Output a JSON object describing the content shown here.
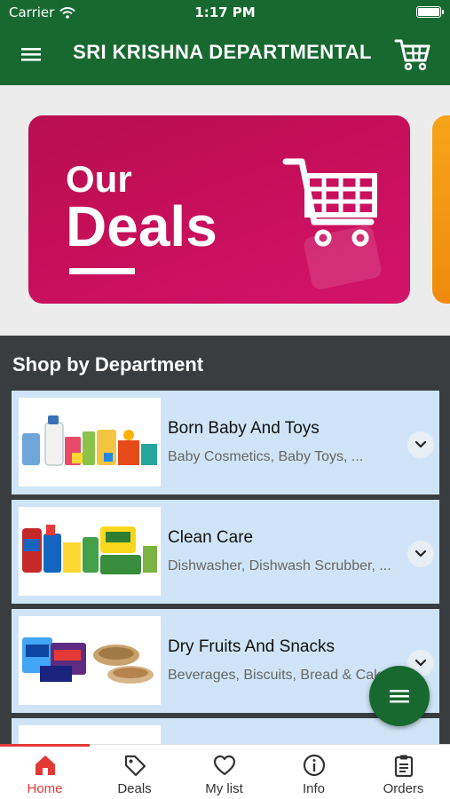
{
  "status_bar": {
    "carrier": "Carrier",
    "time": "1:17 PM"
  },
  "app_bar": {
    "title": "SRI KRISHNA DEPARTMENTAL"
  },
  "banner": {
    "line1": "Our",
    "line2": "Deals"
  },
  "departments": {
    "title": "Shop by Department",
    "items": [
      {
        "name": "Born Baby And Toys",
        "subtitle": "Baby Cosmetics, Baby Toys, ..."
      },
      {
        "name": "Clean Care",
        "subtitle": "Dishwasher, Dishwash Scrubber, ..."
      },
      {
        "name": "Dry Fruits And Snacks",
        "subtitle": "Beverages, Biscuits, Bread & Cake, ..."
      }
    ]
  },
  "tabs": [
    {
      "label": "Home",
      "icon": "home-icon",
      "active": true
    },
    {
      "label": "Deals",
      "icon": "tag-icon"
    },
    {
      "label": "My list",
      "icon": "heart-icon"
    },
    {
      "label": "Info",
      "icon": "info-icon"
    },
    {
      "label": "Orders",
      "icon": "clipboard-icon"
    }
  ],
  "colors": {
    "brand": "#17692f",
    "accent": "#e53935",
    "banner": "#c70f5a",
    "card": "#cfe5f7"
  }
}
